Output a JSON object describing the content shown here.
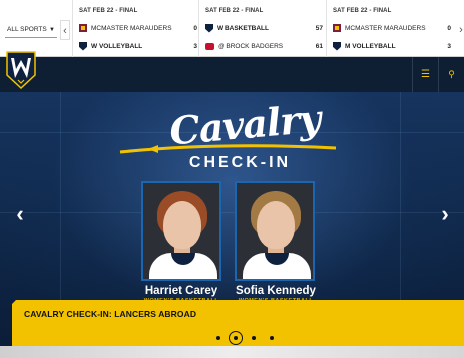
{
  "ticker": {
    "sports_filter": "ALL SPORTS",
    "games": [
      {
        "status": "SAT FEB 22 - FINAL",
        "teams": [
          {
            "name": "MCMASTER MARAUDERS",
            "score": "0",
            "logo": "mcmaster-logo-icon"
          },
          {
            "name": "W VOLLEYBALL",
            "score": "3",
            "logo": "windsor-logo-icon"
          }
        ]
      },
      {
        "status": "SAT FEB 22 - FINAL",
        "teams": [
          {
            "name": "W BASKETBALL",
            "score": "57",
            "logo": "windsor-logo-icon"
          },
          {
            "name": "@ BROCK BADGERS",
            "score": "61",
            "logo": "brock-logo-icon"
          }
        ]
      },
      {
        "status": "SAT FEB 22 - FINAL",
        "teams": [
          {
            "name": "MCMASTER MARAUDERS",
            "score": "0",
            "logo": "mcmaster-logo-icon"
          },
          {
            "name": "M VOLLEYBALL",
            "score": "3",
            "logo": "windsor-logo-icon"
          }
        ]
      }
    ],
    "prev_glyph": "‹",
    "next_glyph": "›"
  },
  "nav": {
    "menu_glyph": "☰",
    "search_glyph": "⚲"
  },
  "hero": {
    "script_title": "Cavalry",
    "subtitle": "CHECK-IN",
    "prev_glyph": "‹",
    "next_glyph": "›",
    "players": [
      {
        "name": "Harriet Carey",
        "sport": "WOMEN'S BASKETBALL"
      },
      {
        "name": "Sofia Kennedy",
        "sport": "WOMEN'S BASKETBALL"
      }
    ],
    "caption": "CAVALRY CHECK-IN: LANCERS ABROAD"
  },
  "carousel": {
    "total": 4,
    "active": 2
  },
  "colors": {
    "brand_navy": "#0f1f33",
    "brand_gold": "#f2c200",
    "hero_blue": "#16345e"
  }
}
